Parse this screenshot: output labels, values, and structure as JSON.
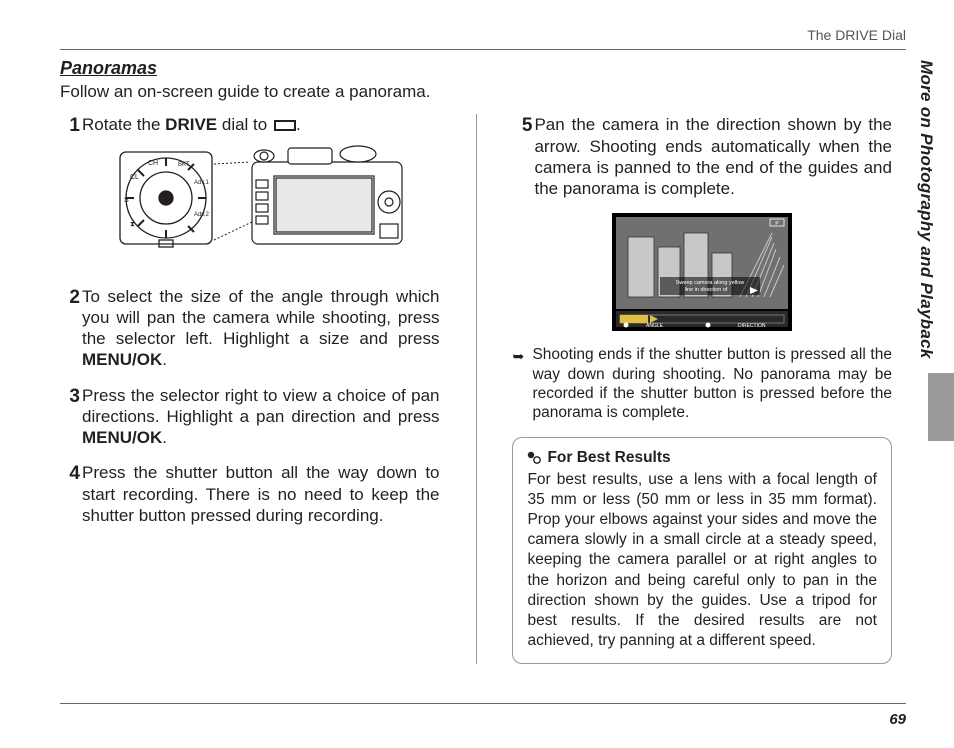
{
  "header": {
    "running_head": "The DRIVE Dial"
  },
  "side_tab": "More on Photography and Playback",
  "section": {
    "title": "Panoramas",
    "intro": "Follow an on-screen guide to create a panorama."
  },
  "steps": {
    "s1_num": "1",
    "s1_a": "Rotate the ",
    "s1_b": "DRIVE",
    "s1_c": " dial to ",
    "s1_d": ".",
    "s2_num": "2",
    "s2_a": "To select the size of the angle through which you will pan the camera while shooting, press the selector left.  Highlight a size and press ",
    "s2_b": "MENU/OK",
    "s2_c": ".",
    "s3_num": "3",
    "s3_a": "Press the selector right to view a choice of pan directions.  Highlight a pan direction and press ",
    "s3_b": "MENU/OK",
    "s3_c": ".",
    "s4_num": "4",
    "s4_body": "Press the shutter button all the way down to start recording.  There is no need to keep the shutter button pressed during recording.",
    "s5_num": "5",
    "s5_body": "Pan the camera in the direction shown by the arrow.  Shooting ends automatically when the camera is panned to the end of the guides and the panorama is complete."
  },
  "pano_screen": {
    "line1": "Sweep camera along yellow",
    "line2": "line in direction of",
    "angle_label": "ANGLE",
    "direction_label": "DIRECTION"
  },
  "note": {
    "body": "Shooting ends if the shutter button is pressed all the way down during shooting.  No panorama may be recorded if the shutter button is pressed before the panorama is complete."
  },
  "tip": {
    "title": "For Best Results",
    "body": "For best results, use a lens with a focal length of 35 mm or less (50 mm or less in 35 mm format).  Prop your elbows against your sides and move the camera slowly in a small circle at a steady speed, keeping the camera parallel or at right angles to the horizon and being careful only to pan in the direction shown by the guides.  Use a tripod for best results.  If the desired results are not achieved, try panning at a different speed."
  },
  "page_number": "69"
}
